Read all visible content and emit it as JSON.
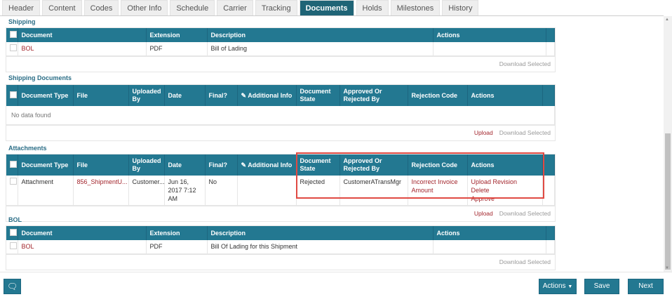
{
  "tabs": [
    "Header",
    "Content",
    "Codes",
    "Other Info",
    "Schedule",
    "Carrier",
    "Tracking",
    "Documents",
    "Holds",
    "Milestones",
    "History"
  ],
  "active_tab": "Documents",
  "shipping": {
    "title": "Shipping",
    "headers": [
      "Document",
      "Extension",
      "Description",
      "Actions"
    ],
    "row": {
      "document": "BOL",
      "extension": "PDF",
      "description": "Bill of Lading"
    },
    "download": "Download Selected"
  },
  "shipping_documents": {
    "title": "Shipping Documents",
    "headers": [
      "Document Type",
      "File",
      "Uploaded By",
      "Date",
      "Final?",
      "Additional Info",
      "Document State",
      "Approved Or Rejected By",
      "Rejection Code",
      "Actions"
    ],
    "empty": "No data found",
    "upload": "Upload",
    "download": "Download Selected"
  },
  "attachments": {
    "title": "Attachments",
    "headers": [
      "Document Type",
      "File",
      "Uploaded By",
      "Date",
      "Final?",
      "Additional Info",
      "Document State",
      "Approved Or Rejected By",
      "Rejection Code",
      "Actions"
    ],
    "row": {
      "type": "Attachment",
      "file": "856_ShipmentU...",
      "uploaded_by": "Customer...",
      "date": "Jun 16, 2017 7:12 AM",
      "final": "No",
      "additional_info": "",
      "state": "Rejected",
      "approved_by": "CustomerATransMgr",
      "rejection_code": "Incorrect Invoice Amount",
      "actions": [
        "Upload Revision",
        "Delete",
        "Approve"
      ]
    },
    "upload": "Upload",
    "download": "Download Selected"
  },
  "bol": {
    "title": "BOL",
    "headers": [
      "Document",
      "Extension",
      "Description",
      "Actions"
    ],
    "row": {
      "document": "BOL",
      "extension": "PDF",
      "description": "Bill Of Lading for this Shipment"
    },
    "download": "Download Selected"
  },
  "footer": {
    "actions": "Actions",
    "save": "Save",
    "next": "Next"
  },
  "colors": {
    "header": "#237891",
    "active_tab": "#1f6476",
    "link": "#a3262d",
    "highlight": "#e04a43"
  }
}
